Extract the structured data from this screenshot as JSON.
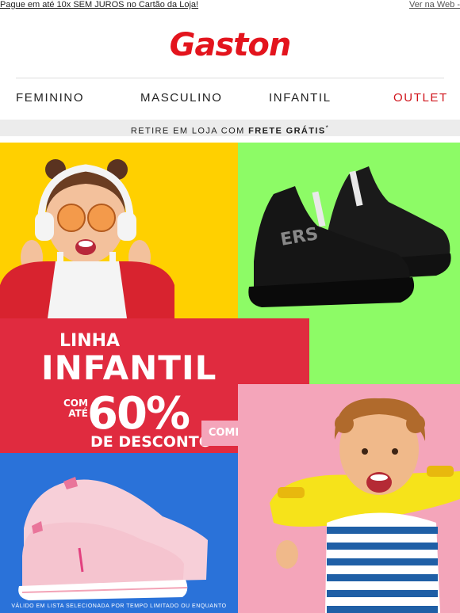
{
  "topbar": {
    "left_link": "Pague em até 10x SEM JUROS no Cartão da Loja!",
    "right_link": "Ver na Web -"
  },
  "brand": {
    "logo": "Gaston",
    "color": "#e3141d"
  },
  "nav": {
    "items": [
      "FEMININO",
      "MASCULINO",
      "INFANTIL",
      "OUTLET"
    ],
    "outlet_color": "#d0141b"
  },
  "freight_bar": {
    "prefix": "RETIRE EM LOJA COM ",
    "bold": "FRETE GRÁTIS",
    "suffix": "*"
  },
  "banner": {
    "line1": "LINHA",
    "line2": "INFANTIL",
    "com": "COM",
    "ate": "ATÉ",
    "percent": "60%",
    "discount": "DE DESCONTO",
    "cta": "COMPRE AGORA",
    "note": "VÁLIDO EM LISTA SELECIONADA POR TEMPO LIMITADO OU ENQUANTO"
  },
  "colors": {
    "yellow": "#ffd000",
    "green": "#8dfb66",
    "red": "#e02b3f",
    "pink": "#f4a5ba",
    "blue": "#2a72d9"
  },
  "images": [
    "girl-with-headphones-image",
    "black-sneakers-image",
    "pink-sneakers-image",
    "boy-with-skateboard-image"
  ]
}
